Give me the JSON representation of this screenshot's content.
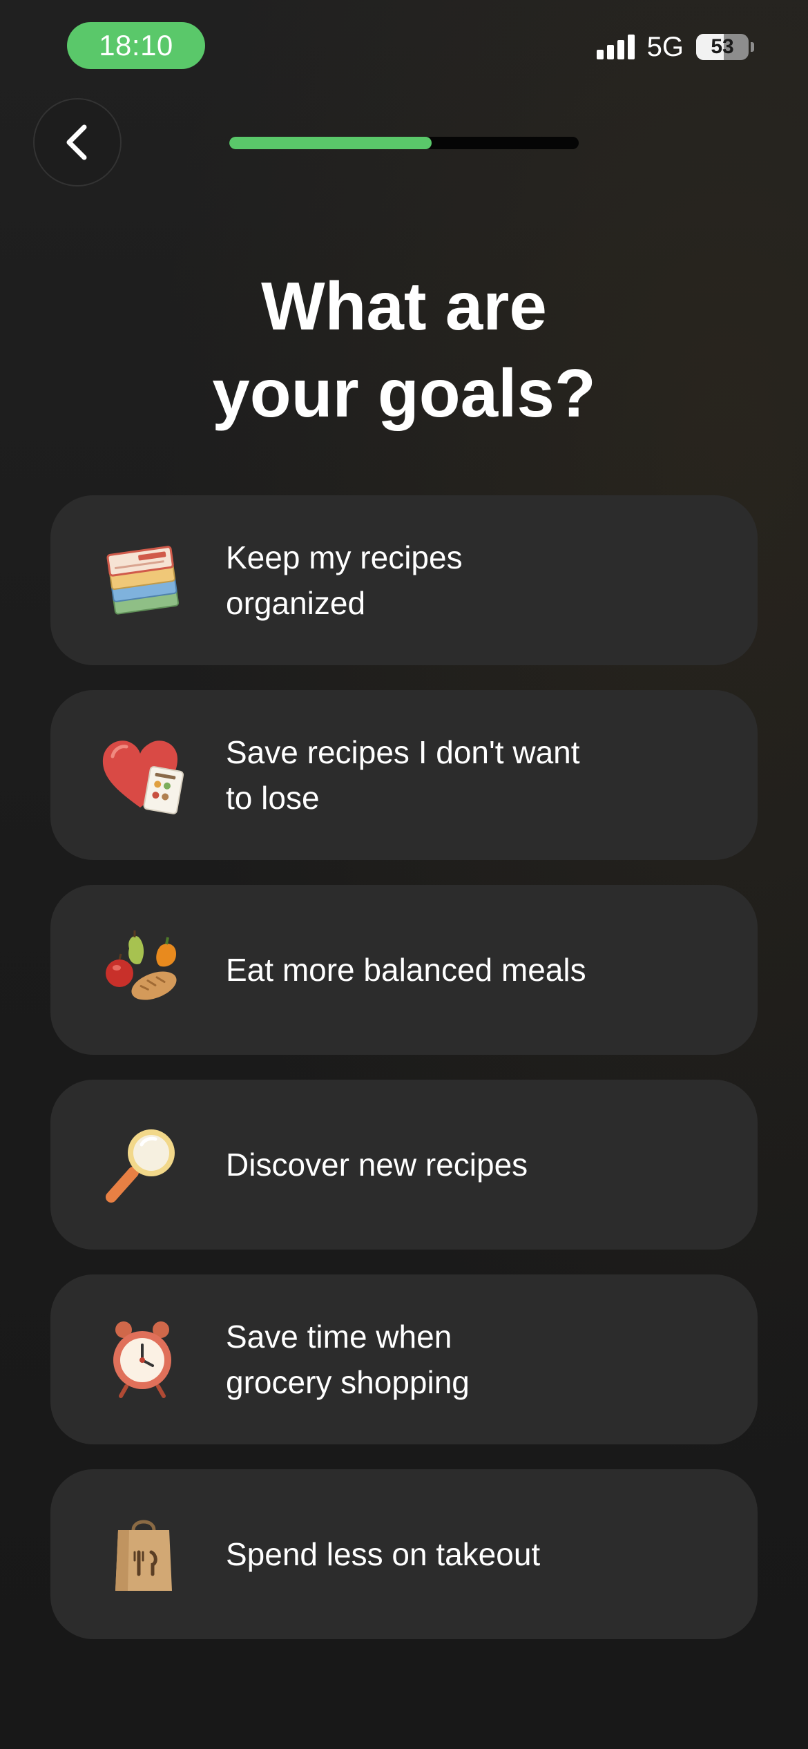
{
  "status_bar": {
    "time": "18:10",
    "network": "5G",
    "battery_level": "53",
    "battery_fraction": 0.53,
    "signal_bars": 4
  },
  "progress": {
    "fraction": 0.58,
    "color": "#5ac86a"
  },
  "back_icon": "chevron-left-icon",
  "title": "What are\nyour goals?",
  "goals": [
    {
      "label": "Keep my recipes\norganized",
      "icon": "recipe-cards-icon"
    },
    {
      "label": "Save recipes I don't want\nto lose",
      "icon": "heart-recipe-icon"
    },
    {
      "label": "Eat more balanced meals",
      "icon": "fruits-bread-icon"
    },
    {
      "label": "Discover new recipes",
      "icon": "magnifying-glass-icon"
    },
    {
      "label": "Save time when\ngrocery shopping",
      "icon": "alarm-clock-icon"
    },
    {
      "label": "Spend less on takeout",
      "icon": "takeout-bag-icon"
    }
  ],
  "colors": {
    "background": "#1c1c1c",
    "card": "#2c2c2c",
    "accent": "#5ac86a"
  }
}
